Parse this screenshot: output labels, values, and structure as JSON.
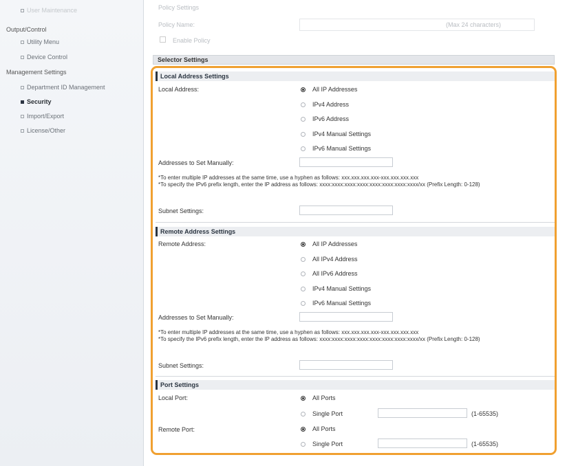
{
  "sidebar": {
    "top_item": "User Maintenance",
    "output_control": "Output/Control",
    "utility_menu": "Utility Menu",
    "device_control": "Device Control",
    "management_settings": "Management Settings",
    "department_id": "Department ID Management",
    "security": "Security",
    "import_export": "Import/Export",
    "license_other": "License/Other"
  },
  "policy": {
    "header": "Policy Settings",
    "name_label": "Policy Name:",
    "name_hint": "(Max 24 characters)",
    "enable_label": "Enable Policy"
  },
  "selector_title": "Selector Settings",
  "local": {
    "title": "Local Address Settings",
    "address_label": "Local Address:",
    "options": [
      "All IP Addresses",
      "IPv4 Address",
      "IPv6 Address",
      "IPv4 Manual Settings",
      "IPv6 Manual Settings"
    ],
    "selected": "All IP Addresses",
    "manual_label": "Addresses to Set Manually:",
    "note1": "*To enter multiple IP addresses at the same time, use a hyphen as follows: xxx.xxx.xxx.xxx-xxx.xxx.xxx.xxx",
    "note2": "*To specify the IPv6 prefix length, enter the IP address as follows: xxxx:xxxx:xxxx:xxxx:xxxx:xxxx:xxxx:xxxx/xx (Prefix Length: 0-128)",
    "subnet_label": "Subnet Settings:"
  },
  "remote": {
    "title": "Remote Address Settings",
    "address_label": "Remote Address:",
    "options": [
      "All IP Addresses",
      "All IPv4 Address",
      "All IPv6 Address",
      "IPv4 Manual Settings",
      "IPv6 Manual Settings"
    ],
    "selected": "All IP Addresses",
    "manual_label": "Addresses to Set Manually:",
    "note1": "*To enter multiple IP addresses at the same time, use a hyphen as follows: xxx.xxx.xxx.xxx-xxx.xxx.xxx.xxx",
    "note2": "*To specify the IPv6 prefix length, enter the IP address as follows: xxxx:xxxx:xxxx:xxxx:xxxx:xxxx:xxxx:xxxx/xx (Prefix Length: 0-128)",
    "subnet_label": "Subnet Settings:"
  },
  "ports": {
    "title": "Port Settings",
    "local_label": "Local Port:",
    "remote_label": "Remote Port:",
    "all_ports": "All Ports",
    "single_port": "Single Port",
    "range": "(1-65535)"
  },
  "colors": {
    "highlight": "#f0a030",
    "section_accent": "#2b3541"
  }
}
